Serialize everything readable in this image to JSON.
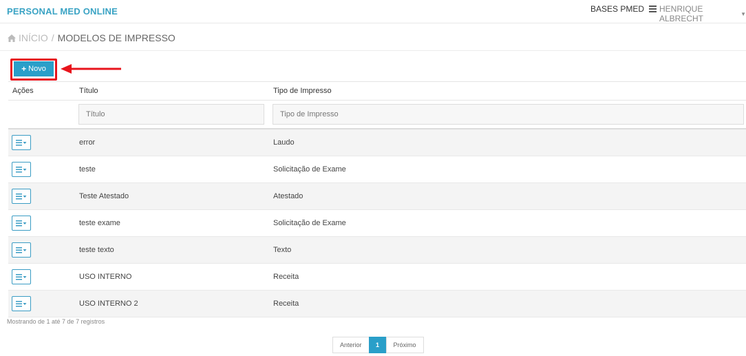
{
  "header": {
    "brand": "PERSONAL MED ONLINE",
    "bases_label": "BASES PMED",
    "bases_icon": "database-icon",
    "user_name": "HENRIQUE ALBRECHT",
    "user_caret": "chevron-down-icon"
  },
  "breadcrumb": {
    "home_icon": "home-icon",
    "home": "INÍCIO",
    "separator": "/",
    "current": "MODELOS DE IMPRESSO"
  },
  "toolbar": {
    "new_plus": "+",
    "new_label": "Novo",
    "highlight_color": "#e8141c"
  },
  "table": {
    "columns": [
      "Ações",
      "Título",
      "Tipo de Impresso"
    ],
    "filters": {
      "title_placeholder": "Título",
      "type_placeholder": "Tipo de Impresso"
    },
    "action_icon": "menu-dropdown-icon",
    "rows": [
      {
        "title": "error",
        "type": "Laudo"
      },
      {
        "title": "teste",
        "type": "Solicitação de Exame"
      },
      {
        "title": "Teste Atestado",
        "type": "Atestado"
      },
      {
        "title": "teste exame",
        "type": "Solicitação de Exame"
      },
      {
        "title": "teste texto",
        "type": "Texto"
      },
      {
        "title": "USO INTERNO",
        "type": "Receita"
      },
      {
        "title": "USO INTERNO 2",
        "type": "Receita"
      }
    ]
  },
  "footer": {
    "info": "Mostrando de 1 até 7 de 7 registros",
    "pagination": {
      "previous": "Anterior",
      "current_page": "1",
      "next": "Próximo"
    }
  },
  "colors": {
    "accent": "#2a9fc9",
    "brand": "#3aa3c4"
  }
}
